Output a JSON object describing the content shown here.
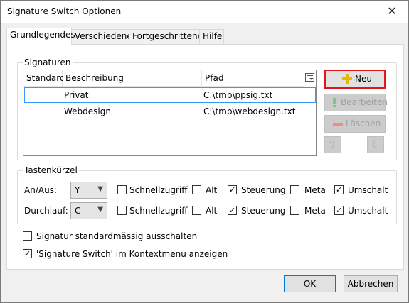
{
  "window": {
    "title": "Signature Switch Optionen",
    "close_glyph": "✕"
  },
  "tabs": [
    "Grundlegendes",
    "Verschiedenes",
    "Fortgeschrittenes",
    "Hilfe"
  ],
  "signatures": {
    "legend": "Signaturen",
    "columns": [
      "Standard",
      "Beschreibung",
      "Pfad"
    ],
    "rows": [
      {
        "standard": "",
        "beschreibung": "Privat",
        "pfad": "C:\\tmp\\ppsig.txt"
      },
      {
        "standard": "",
        "beschreibung": "Webdesign",
        "pfad": "C:\\tmp\\webdesign.txt"
      }
    ],
    "buttons": {
      "new": "Neu",
      "edit": "Bearbeiten",
      "delete": "Löschen"
    }
  },
  "shortcuts": {
    "legend": "Tastenkürzel",
    "rows": [
      {
        "label": "An/Aus:",
        "key": "Y",
        "schnellzugriff": false,
        "alt": false,
        "steuerung": true,
        "meta": false,
        "umschalt": true
      },
      {
        "label": "Durchlauf:",
        "key": "C",
        "schnellzugriff": false,
        "alt": false,
        "steuerung": true,
        "meta": false,
        "umschalt": true
      }
    ],
    "modifier_labels": {
      "schnellzugriff": "Schnellzugriff",
      "alt": "Alt",
      "steuerung": "Steuerung",
      "meta": "Meta",
      "umschalt": "Umschalt"
    }
  },
  "options": [
    {
      "label": "Signatur standardmässig ausschalten",
      "checked": false
    },
    {
      "label": "'Signature Switch' im Kontextmenu anzeigen",
      "checked": true
    }
  ],
  "footer": {
    "ok": "OK",
    "cancel": "Abbrechen"
  }
}
